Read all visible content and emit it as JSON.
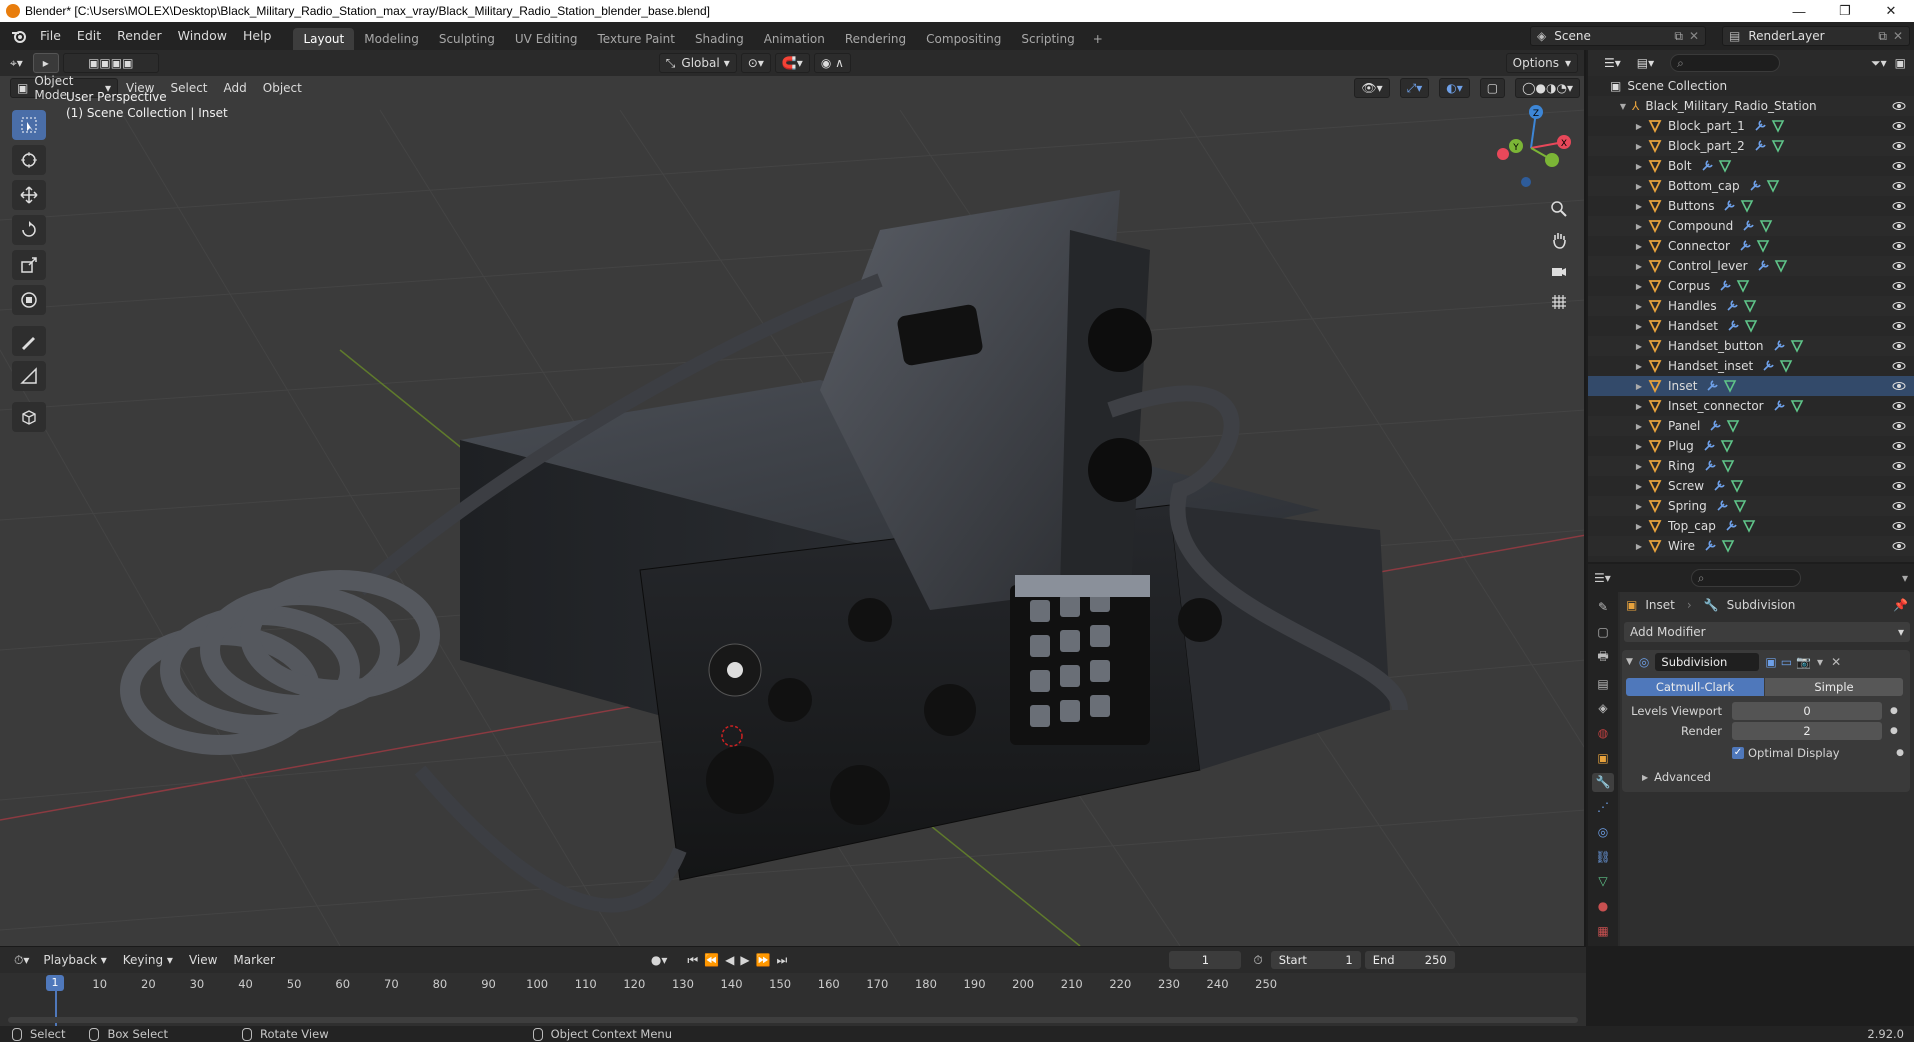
{
  "window": {
    "title": "Blender* [C:\\Users\\MOLEX\\Desktop\\Black_Military_Radio_Station_max_vray/Black_Military_Radio_Station_blender_base.blend]",
    "minimize": "—",
    "maximize": "❐",
    "close": "✕"
  },
  "menu": [
    "File",
    "Edit",
    "Render",
    "Window",
    "Help"
  ],
  "workspaces": [
    "Layout",
    "Modeling",
    "Sculpting",
    "UV Editing",
    "Texture Paint",
    "Shading",
    "Animation",
    "Rendering",
    "Compositing",
    "Scripting"
  ],
  "active_workspace": "Layout",
  "scene": {
    "name": "Scene",
    "render_layer": "RenderLayer"
  },
  "viewport": {
    "orientation": "Global",
    "options_label": "Options",
    "mode": "Object Mode",
    "menus": [
      "View",
      "Select",
      "Add",
      "Object"
    ],
    "perspective": "User Perspective",
    "collection_info": "(1) Scene Collection | Inset",
    "gizmo": {
      "z": "Z",
      "y": "Y",
      "x": "X"
    }
  },
  "outliner": {
    "root": "Scene Collection",
    "collection": "Black_Military_Radio_Station",
    "objects": [
      "Block_part_1",
      "Block_part_2",
      "Bolt",
      "Bottom_cap",
      "Buttons",
      "Compound",
      "Connector",
      "Control_lever",
      "Corpus",
      "Handles",
      "Handset",
      "Handset_button",
      "Handset_inset",
      "Inset",
      "Inset_connector",
      "Panel",
      "Plug",
      "Ring",
      "Screw",
      "Spring",
      "Top_cap",
      "Wire"
    ],
    "active_object": "Inset"
  },
  "properties": {
    "breadcrumb_object": "Inset",
    "breadcrumb_modifier": "Subdivision",
    "add_modifier": "Add Modifier",
    "modifier_name": "Subdivision",
    "subdiv_type_a": "Catmull-Clark",
    "subdiv_type_b": "Simple",
    "levels_viewport_label": "Levels Viewport",
    "levels_viewport": "0",
    "render_label": "Render",
    "render": "2",
    "optimal_display": "Optimal Display",
    "advanced": "Advanced"
  },
  "timeline": {
    "menus": [
      "Playback",
      "Keying",
      "View",
      "Marker"
    ],
    "current_frame": "1",
    "start_label": "Start",
    "start": "1",
    "end_label": "End",
    "end": "250",
    "ticks": [
      "1",
      "10",
      "20",
      "30",
      "40",
      "50",
      "60",
      "70",
      "80",
      "90",
      "100",
      "110",
      "120",
      "130",
      "140",
      "150",
      "160",
      "170",
      "180",
      "190",
      "200",
      "210",
      "220",
      "230",
      "240",
      "250"
    ]
  },
  "status": {
    "select": "Select",
    "box_select": "Box Select",
    "rotate_view": "Rotate View",
    "context_menu": "Object Context Menu",
    "version": "2.92.0"
  },
  "colors": {
    "accent_blue": "#4f78bb",
    "object_orange": "#e8a33d",
    "mesh_green": "#5fc489",
    "axis_x": "#e8485a",
    "axis_y": "#7bb536",
    "axis_z": "#3d86d6"
  }
}
